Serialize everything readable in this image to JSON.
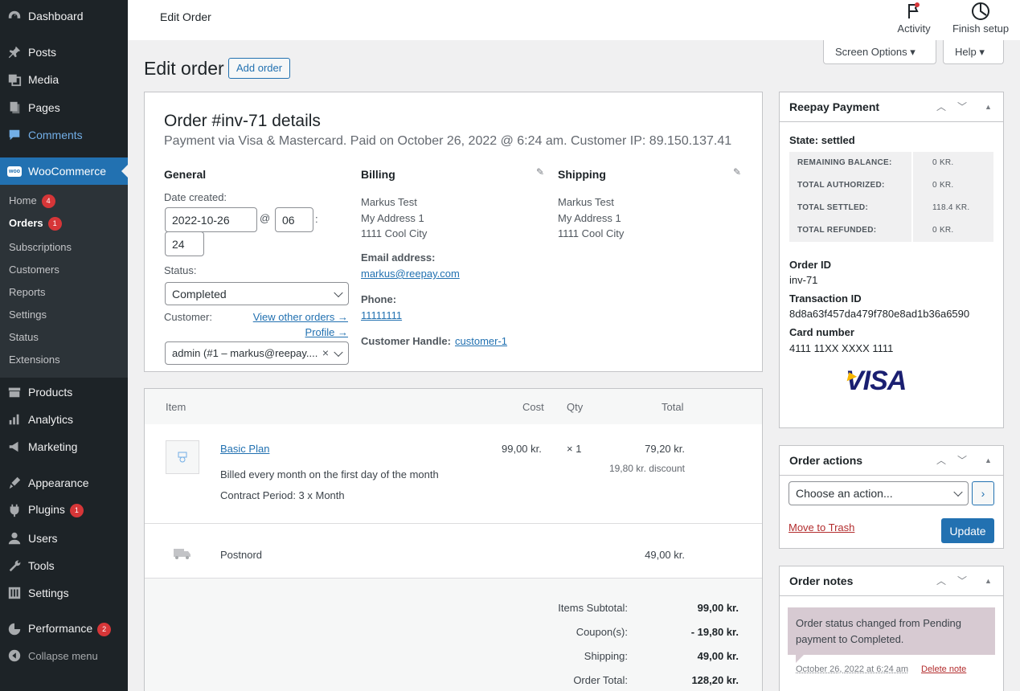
{
  "sidebar": {
    "items": [
      {
        "label": "Dashboard",
        "icon": "dashboard-icon"
      },
      {
        "label": "Posts",
        "icon": "pin-icon"
      },
      {
        "label": "Media",
        "icon": "media-icon"
      },
      {
        "label": "Pages",
        "icon": "pages-icon"
      },
      {
        "label": "Comments",
        "icon": "comments-icon"
      },
      {
        "label": "WooCommerce",
        "icon": "woo-icon"
      },
      {
        "label": "Products",
        "icon": "products-icon"
      },
      {
        "label": "Analytics",
        "icon": "analytics-icon"
      },
      {
        "label": "Marketing",
        "icon": "marketing-icon"
      },
      {
        "label": "Appearance",
        "icon": "appearance-icon"
      },
      {
        "label": "Plugins",
        "icon": "plugins-icon",
        "badge": "1"
      },
      {
        "label": "Users",
        "icon": "users-icon"
      },
      {
        "label": "Tools",
        "icon": "tools-icon"
      },
      {
        "label": "Settings",
        "icon": "settings-icon"
      },
      {
        "label": "Performance",
        "icon": "performance-icon",
        "badge": "2"
      },
      {
        "label": "Collapse menu",
        "icon": "collapse-icon"
      }
    ],
    "woo_badge_text": "woo",
    "submenu": [
      {
        "label": "Home",
        "badge": "4"
      },
      {
        "label": "Orders",
        "badge": "1"
      },
      {
        "label": "Subscriptions"
      },
      {
        "label": "Customers"
      },
      {
        "label": "Reports"
      },
      {
        "label": "Settings"
      },
      {
        "label": "Status"
      },
      {
        "label": "Extensions"
      }
    ]
  },
  "topbar": {
    "title": "Edit Order",
    "activity": "Activity",
    "finish_setup": "Finish setup"
  },
  "screen_options": "Screen Options ▾",
  "help": "Help ▾",
  "page": {
    "heading": "Edit order",
    "add_order": "Add order"
  },
  "order": {
    "title": "Order #inv-71 details",
    "subtitle": "Payment via Visa & Mastercard. Paid on October 26, 2022 @ 6:24 am. Customer IP: 89.150.137.41",
    "general": {
      "heading": "General",
      "date_label": "Date created:",
      "date": "2022-10-26",
      "at": "@",
      "hour": "06",
      "colon": ":",
      "minute": "24",
      "status_label": "Status:",
      "status": "Completed",
      "customer_label": "Customer:",
      "view_other_orders": "View other orders →",
      "profile": "Profile →",
      "customer": "admin (#1 – markus@reepay....",
      "clear": "×"
    },
    "billing": {
      "heading": "Billing",
      "name": "Markus Test",
      "address1": "My Address 1",
      "city": "1111 Cool City",
      "email_label": "Email address:",
      "email": "markus@reepay.com",
      "phone_label": "Phone:",
      "phone": "11111111",
      "handle_label": "Customer Handle:",
      "handle": "customer-1"
    },
    "shipping": {
      "heading": "Shipping",
      "name": "Markus Test",
      "address1": "My Address 1",
      "city": "1111 Cool City"
    }
  },
  "items": {
    "headers": {
      "item": "Item",
      "cost": "Cost",
      "qty": "Qty",
      "total": "Total"
    },
    "line": {
      "name": "Basic Plan",
      "meta1": "Billed every month on the first day of the month",
      "meta2": "Contract Period: 3 x Month",
      "cost": "99,00 kr.",
      "qty": "× 1",
      "total": "79,20 kr.",
      "discount": "19,80 kr. discount"
    },
    "shipping": {
      "name": "Postnord",
      "total": "49,00 kr."
    },
    "totals": [
      {
        "label": "Items Subtotal:",
        "value": "99,00 kr."
      },
      {
        "label": "Coupon(s):",
        "value": "- 19,80 kr."
      },
      {
        "label": "Shipping:",
        "value": "49,00 kr."
      },
      {
        "label": "Order Total:",
        "value": "128,20 kr."
      }
    ]
  },
  "reepay": {
    "heading": "Reepay Payment",
    "state": "State: settled",
    "rows": [
      {
        "k": "REMAINING BALANCE:",
        "v": "0 KR."
      },
      {
        "k": "TOTAL AUTHORIZED:",
        "v": "0 KR."
      },
      {
        "k": "TOTAL SETTLED:",
        "v": "118.4 KR."
      },
      {
        "k": "TOTAL REFUNDED:",
        "v": "0 KR."
      }
    ],
    "order_id_label": "Order ID",
    "order_id": "inv-71",
    "transaction_label": "Transaction ID",
    "transaction": "8d8a63f457da479f780e8ad1b36a6590",
    "card_label": "Card number",
    "card": "4111 11XX XXXX 1111",
    "card_brand": "VISA"
  },
  "order_actions": {
    "heading": "Order actions",
    "select": "Choose an action...",
    "trash": "Move to Trash",
    "update": "Update"
  },
  "order_notes": {
    "heading": "Order notes",
    "note": "Order status changed from Pending payment to Completed.",
    "date": "October 26, 2022 at 6:24 am",
    "delete": "Delete note"
  },
  "colors": {
    "accent": "#2271b1",
    "sidebar": "#1d2327",
    "badge": "#d63638",
    "note": "#d7cad2"
  }
}
